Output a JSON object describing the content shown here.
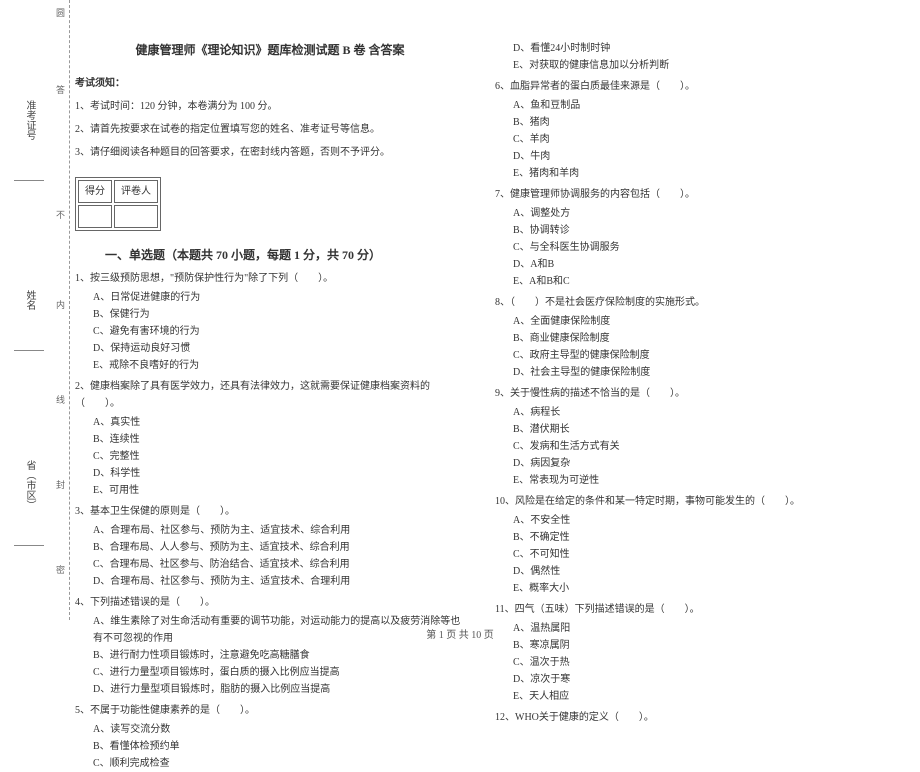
{
  "binding": {
    "marks": [
      "圆",
      "答",
      "不",
      "内",
      "线",
      "封",
      "密"
    ],
    "labels": {
      "ticket": "准考证号",
      "name": "姓名",
      "district": "省（市区）"
    }
  },
  "title": "健康管理师《理论知识》题库检测试题 B 卷  含答案",
  "notice_label": "考试须知：",
  "instructions": [
    "1、考试时间：120 分钟，本卷满分为 100 分。",
    "2、请首先按要求在试卷的指定位置填写您的姓名、准考证号等信息。",
    "3、请仔细阅读各种题目的回答要求，在密封线内答题，否则不予评分。"
  ],
  "score_table": {
    "c1": "得分",
    "c2": "评卷人"
  },
  "part1_title": "一、单选题（本题共 70 小题，每题 1 分，共 70 分）",
  "left_questions": [
    {
      "stem": "1、按三级预防思想，\"预防保护性行为\"除了下列（　　）。",
      "opts": [
        "A、日常促进健康的行为",
        "B、保健行为",
        "C、避免有害环境的行为",
        "D、保持运动良好习惯",
        "E、戒除不良嗜好的行为"
      ]
    },
    {
      "stem": "2、健康档案除了具有医学效力，还具有法律效力，这就需要保证健康档案资料的（　　）。",
      "opts": [
        "A、真实性",
        "B、连续性",
        "C、完整性",
        "D、科学性",
        "E、可用性"
      ]
    },
    {
      "stem": "3、基本卫生保健的原则是（　　）。",
      "opts": [
        "A、合理布局、社区参与、预防为主、适宜技术、综合利用",
        "B、合理布局、人人参与、预防为主、适宜技术、综合利用",
        "C、合理布局、社区参与、防治结合、适宜技术、综合利用",
        "D、合理布局、社区参与、预防为主、适宜技术、合理利用"
      ]
    },
    {
      "stem": "4、下列描述错误的是（　　）。",
      "opts": [
        "A、维生素除了对生命活动有重要的调节功能，对运动能力的提高以及疲劳消除等也有不可忽视的作用",
        "B、进行耐力性项目锻炼时，注意避免吃高糖膳食",
        "C、进行力量型项目锻炼时，蛋白质的摄入比例应当提高",
        "D、进行力量型项目锻炼时，脂肪的摄入比例应当提高"
      ]
    },
    {
      "stem": "5、不属于功能性健康素养的是（　　）。",
      "opts": [
        "A、读写交流分数",
        "B、看懂体检预约单",
        "C、顺利完成检查"
      ]
    }
  ],
  "right_questions_prefix": [
    "D、看懂24小时制时钟",
    "E、对获取的健康信息加以分析判断"
  ],
  "right_questions": [
    {
      "stem": "6、血脂异常者的蛋白质最佳来源是（　　）。",
      "opts": [
        "A、鱼和豆制品",
        "B、猪肉",
        "C、羊肉",
        "D、牛肉",
        "E、猪肉和羊肉"
      ]
    },
    {
      "stem": "7、健康管理师协调服务的内容包括（　　）。",
      "opts": [
        "A、调整处方",
        "B、协调转诊",
        "C、与全科医生协调服务",
        "D、A和B",
        "E、A和B和C"
      ]
    },
    {
      "stem": "8、（　　）不是社会医疗保险制度的实施形式。",
      "opts": [
        "A、全面健康保险制度",
        "B、商业健康保险制度",
        "C、政府主导型的健康保险制度",
        "D、社会主导型的健康保险制度"
      ]
    },
    {
      "stem": "9、关于慢性病的描述不恰当的是（　　）。",
      "opts": [
        "A、病程长",
        "B、潜伏期长",
        "C、发病和生活方式有关",
        "D、病因复杂",
        "E、常表现为可逆性"
      ]
    },
    {
      "stem": "10、风险是在给定的条件和某一特定时期，事物可能发生的（　　）。",
      "opts": [
        "A、不安全性",
        "B、不确定性",
        "C、不可知性",
        "D、偶然性",
        "E、概率大小"
      ]
    },
    {
      "stem": "11、四气（五味）下列描述错误的是（　　）。",
      "opts": [
        "A、温热属阳",
        "B、寒凉属阴",
        "C、温次于热",
        "D、凉次于寒",
        "E、天人相应"
      ]
    },
    {
      "stem": "12、WHO关于健康的定义（　　）。",
      "opts": []
    }
  ],
  "footer": "第 1 页 共 10 页"
}
